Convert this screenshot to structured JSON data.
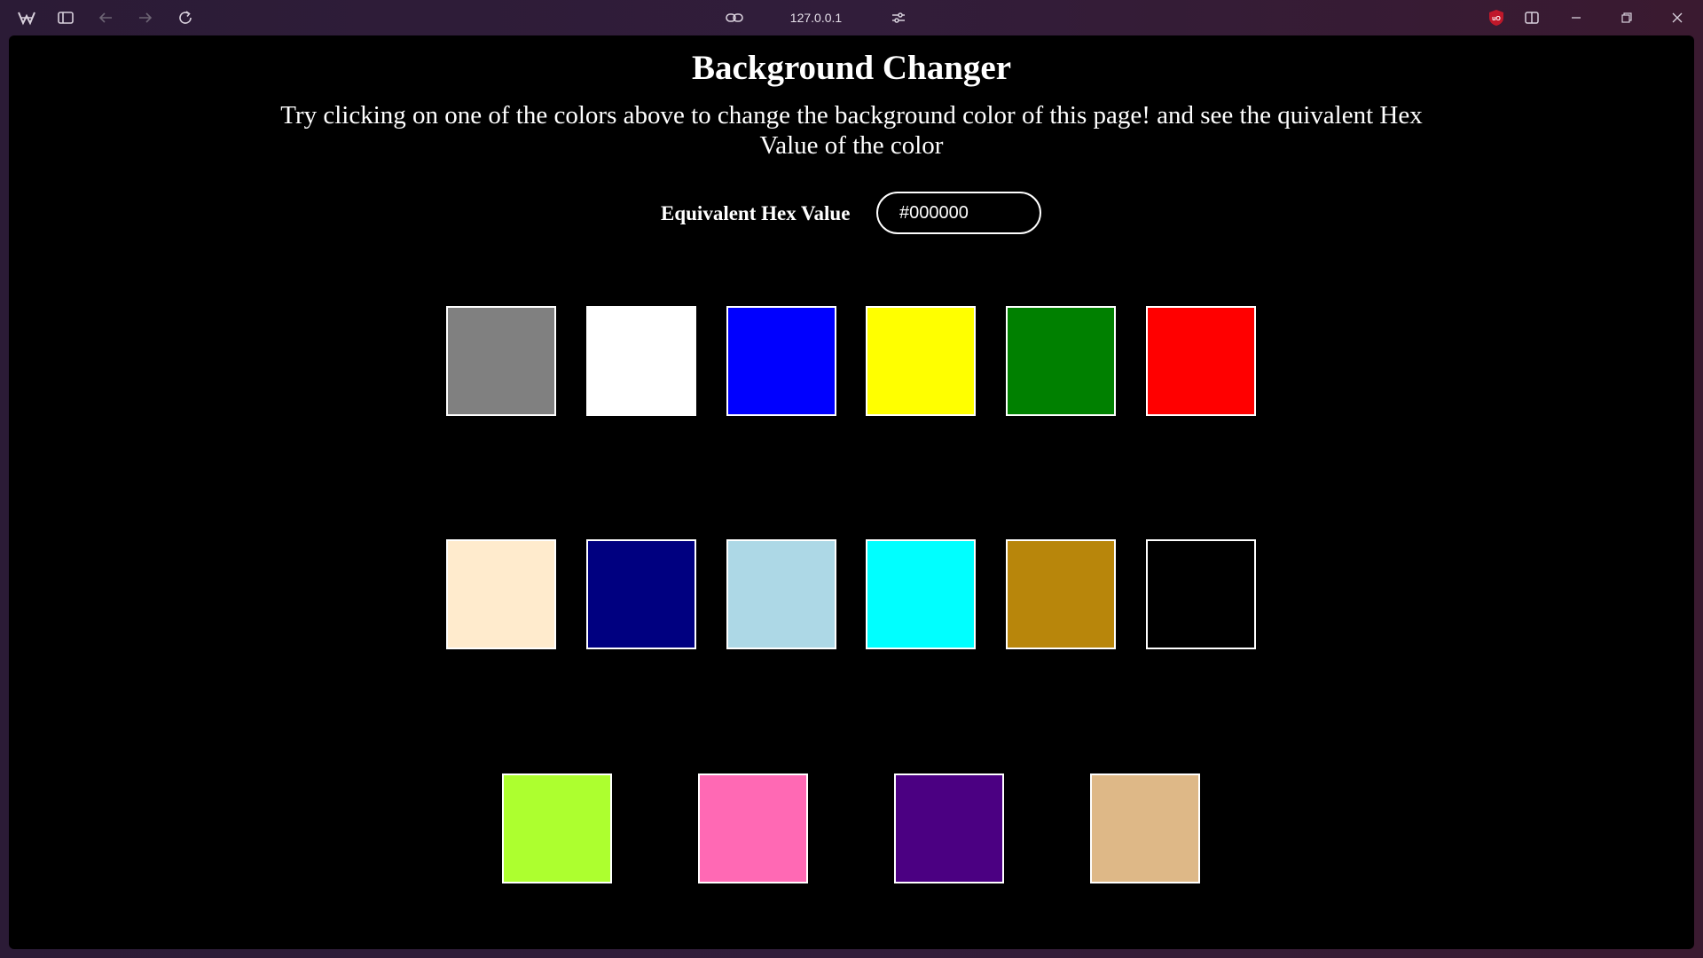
{
  "browser": {
    "address": "127.0.0.1"
  },
  "page": {
    "title": "Background Changer",
    "description": "Try clicking on one of the colors above to change the background color of this page! and see the quivalent Hex Value of the color",
    "hex_label": "Equivalent Hex Value",
    "hex_value": "#000000",
    "background_color": "#000000"
  },
  "swatches": [
    {
      "color": "#808080"
    },
    {
      "color": "#ffffff"
    },
    {
      "color": "#0000ff"
    },
    {
      "color": "#ffff00"
    },
    {
      "color": "#008000"
    },
    {
      "color": "#ff0000"
    },
    {
      "color": "#ffebcd"
    },
    {
      "color": "#000080"
    },
    {
      "color": "#add8e6"
    },
    {
      "color": "#00ffff"
    },
    {
      "color": "#b8860b"
    },
    {
      "color": "#000000"
    },
    {
      "color": "#adff2f"
    },
    {
      "color": "#ff69b4"
    },
    {
      "color": "#4b0082"
    },
    {
      "color": "#deb887"
    }
  ]
}
